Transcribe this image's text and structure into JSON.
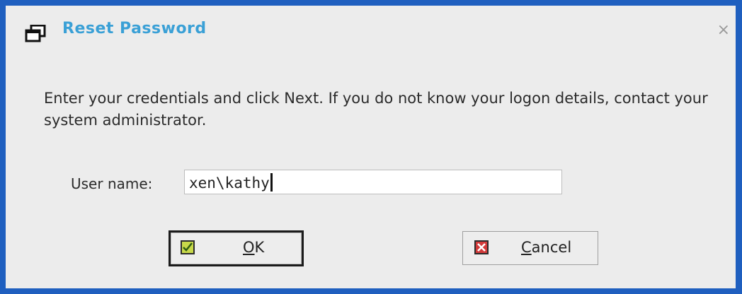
{
  "dialog": {
    "title": "Reset Password",
    "close_symbol": "×",
    "message": "Enter your credentials and click Next. If you do not know your logon details, contact your system administrator.",
    "username": {
      "label": "User name:",
      "value": "xen\\kathy"
    },
    "buttons": {
      "ok": {
        "mnemonic": "O",
        "rest": "K",
        "icon": "checkmark-icon"
      },
      "cancel": {
        "mnemonic": "C",
        "rest": "ancel",
        "icon": "cancel-x-icon"
      }
    }
  },
  "colors": {
    "frame": "#1f5fbf",
    "title": "#3aa0d6",
    "dialog_bg": "#ececec"
  }
}
